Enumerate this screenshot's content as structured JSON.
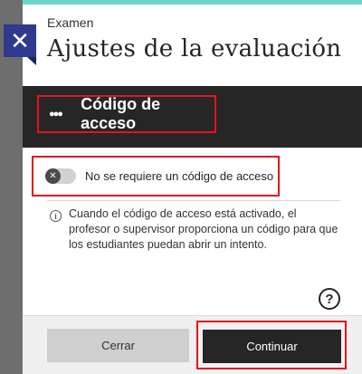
{
  "close_button": {
    "icon": "close-icon",
    "glyph": "✕"
  },
  "header": {
    "eyebrow": "Examen",
    "title": "Ajustes de la evaluación"
  },
  "section": {
    "icon": "group-icon",
    "title": "Código de acceso"
  },
  "access_code_toggle": {
    "state": "off",
    "knob_glyph": "✕",
    "label": "No se requiere un código de acceso"
  },
  "info": {
    "icon": "info-icon",
    "glyph": "i",
    "text": "Cuando el código de acceso está activado, el profesor o supervisor proporciona un código para que los estudiantes puedan abrir un intento."
  },
  "help": {
    "icon": "help-icon",
    "glyph": "?"
  },
  "footer": {
    "cancel_label": "Cerrar",
    "continue_label": "Continuar"
  },
  "colors": {
    "accent": "#6dd6c8",
    "highlight": "#e3141b",
    "close_bg": "#2f3a8c",
    "dark": "#262626"
  }
}
